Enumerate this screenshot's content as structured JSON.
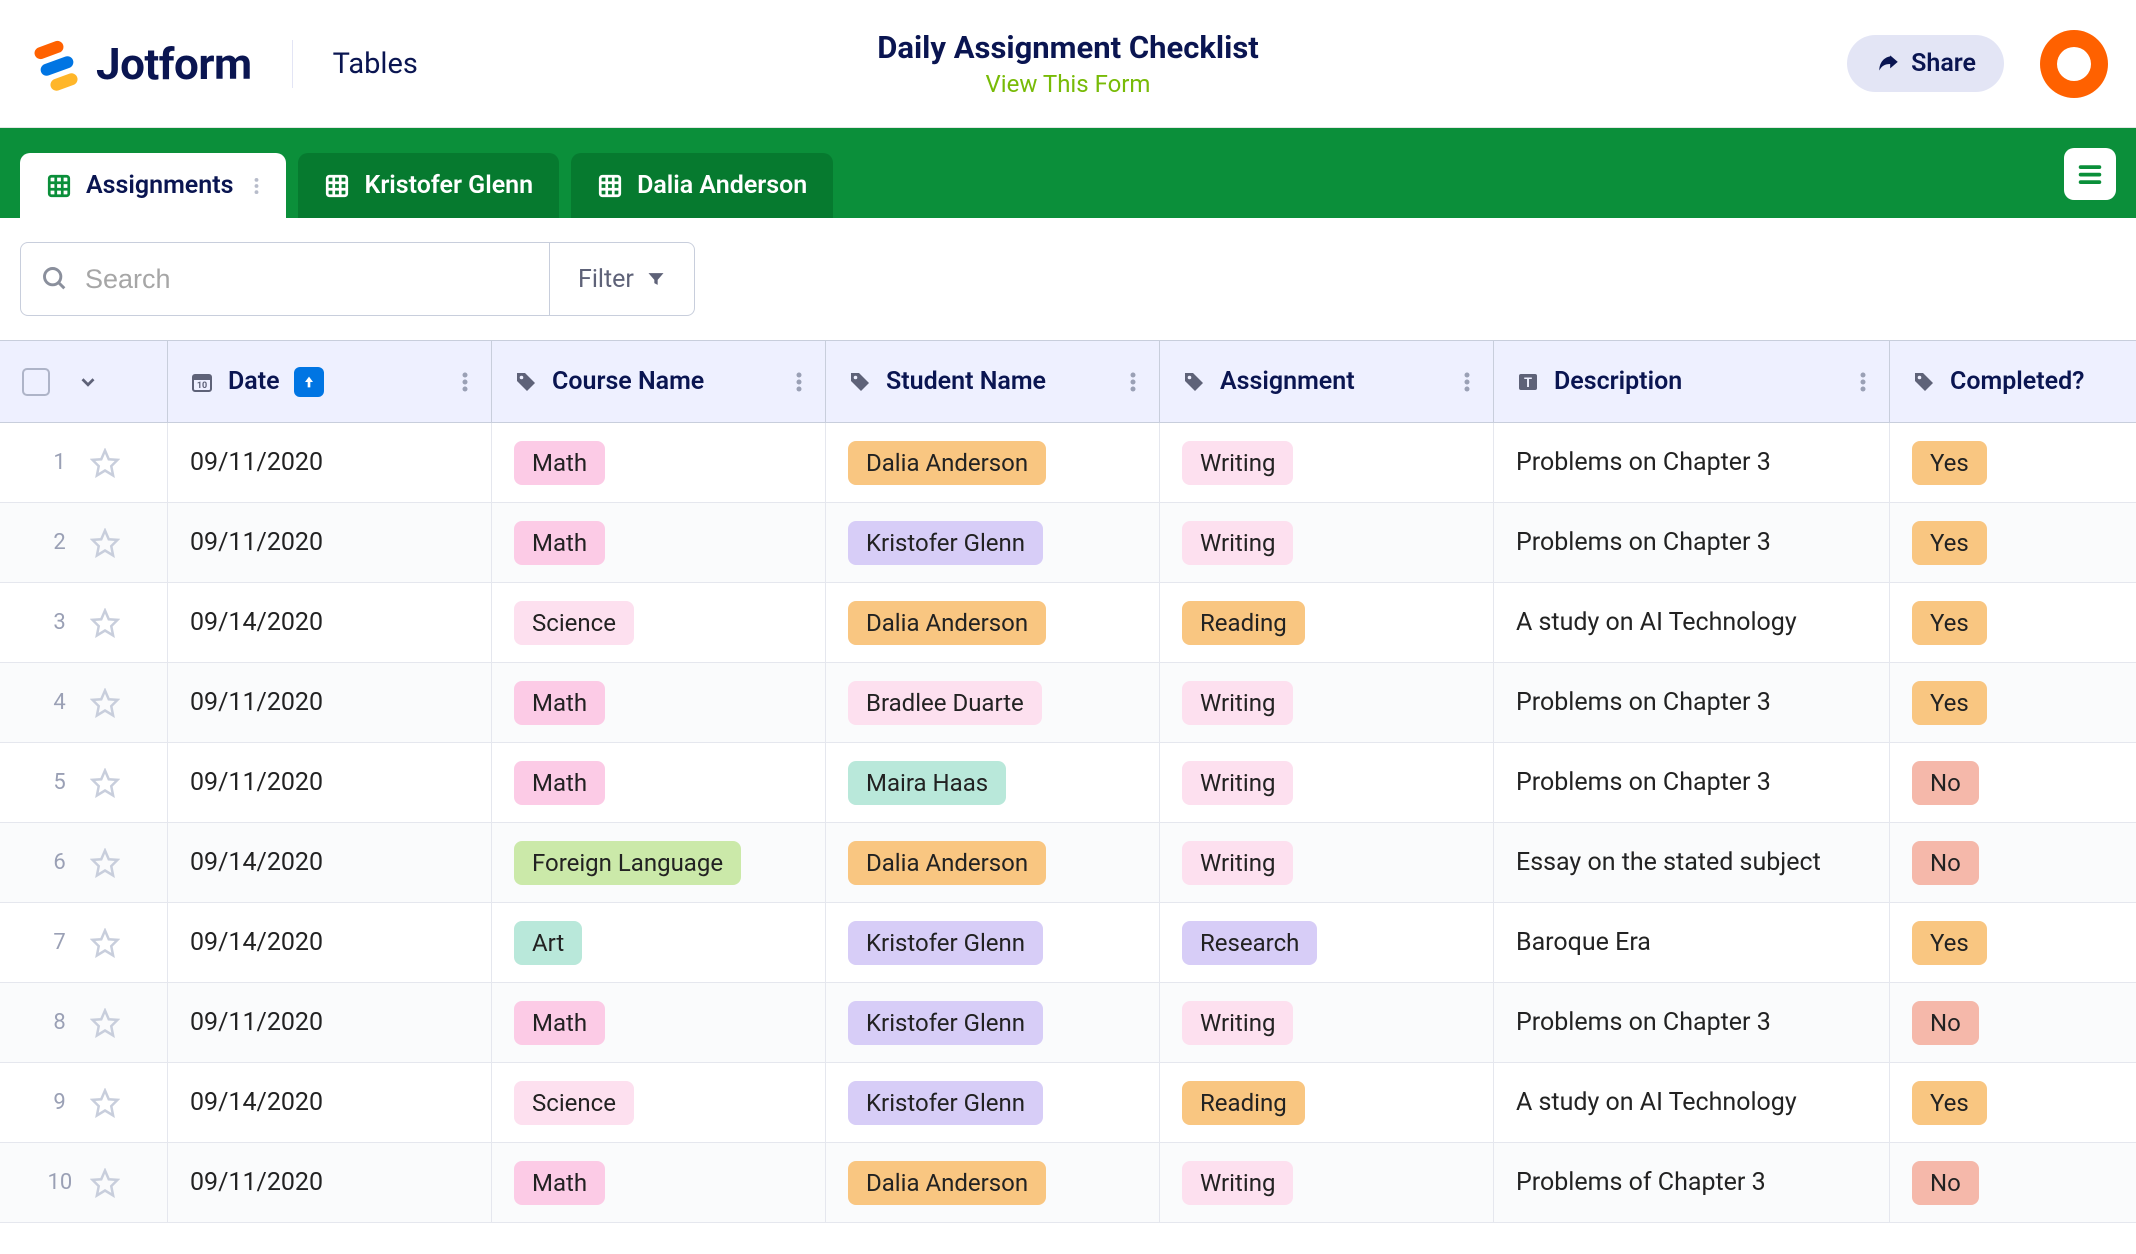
{
  "brand": "Jotform",
  "section_label": "Tables",
  "page_title": "Daily Assignment Checklist",
  "view_form_label": "View This Form",
  "share_label": "Share",
  "tabs": [
    {
      "label": "Assignments",
      "active": true
    },
    {
      "label": "Kristofer Glenn",
      "active": false
    },
    {
      "label": "Dalia Anderson",
      "active": false
    }
  ],
  "search_placeholder": "Search",
  "filter_label": "Filter",
  "columns": {
    "date": "Date",
    "course": "Course Name",
    "student": "Student Name",
    "assignment": "Assignment",
    "description": "Description",
    "completed": "Completed?"
  },
  "pill_classes": {
    "Math": "pill-pink",
    "Science": "pill-mag",
    "Foreign Language": "pill-green",
    "Art": "pill-mint",
    "Dalia Anderson": "pill-orange",
    "Kristofer Glenn": "pill-lav",
    "Bradlee Duarte": "pill-mag",
    "Maira Haas": "pill-mint",
    "Writing": "pill-mag",
    "Reading": "pill-orange",
    "Research": "pill-lav",
    "Yes": "pill-orange",
    "No": "pill-salmon"
  },
  "rows": [
    {
      "date": "09/11/2020",
      "course": "Math",
      "student": "Dalia Anderson",
      "assignment": "Writing",
      "description": "Problems on Chapter 3",
      "completed": "Yes"
    },
    {
      "date": "09/11/2020",
      "course": "Math",
      "student": "Kristofer Glenn",
      "assignment": "Writing",
      "description": "Problems on Chapter 3",
      "completed": "Yes"
    },
    {
      "date": "09/14/2020",
      "course": "Science",
      "student": "Dalia Anderson",
      "assignment": "Reading",
      "description": "A study on AI Technology",
      "completed": "Yes"
    },
    {
      "date": "09/11/2020",
      "course": "Math",
      "student": "Bradlee Duarte",
      "assignment": "Writing",
      "description": "Problems on Chapter 3",
      "completed": "Yes"
    },
    {
      "date": "09/11/2020",
      "course": "Math",
      "student": "Maira Haas",
      "assignment": "Writing",
      "description": "Problems on Chapter 3",
      "completed": "No"
    },
    {
      "date": "09/14/2020",
      "course": "Foreign Language",
      "student": "Dalia Anderson",
      "assignment": "Writing",
      "description": "Essay on the stated subject",
      "completed": "No"
    },
    {
      "date": "09/14/2020",
      "course": "Art",
      "student": "Kristofer Glenn",
      "assignment": "Research",
      "description": "Baroque Era",
      "completed": "Yes"
    },
    {
      "date": "09/11/2020",
      "course": "Math",
      "student": "Kristofer Glenn",
      "assignment": "Writing",
      "description": "Problems on Chapter 3",
      "completed": "No"
    },
    {
      "date": "09/14/2020",
      "course": "Science",
      "student": "Kristofer Glenn",
      "assignment": "Reading",
      "description": "A study on AI Technology",
      "completed": "Yes"
    },
    {
      "date": "09/11/2020",
      "course": "Math",
      "student": "Dalia Anderson",
      "assignment": "Writing",
      "description": "Problems of Chapter 3",
      "completed": "No"
    }
  ]
}
